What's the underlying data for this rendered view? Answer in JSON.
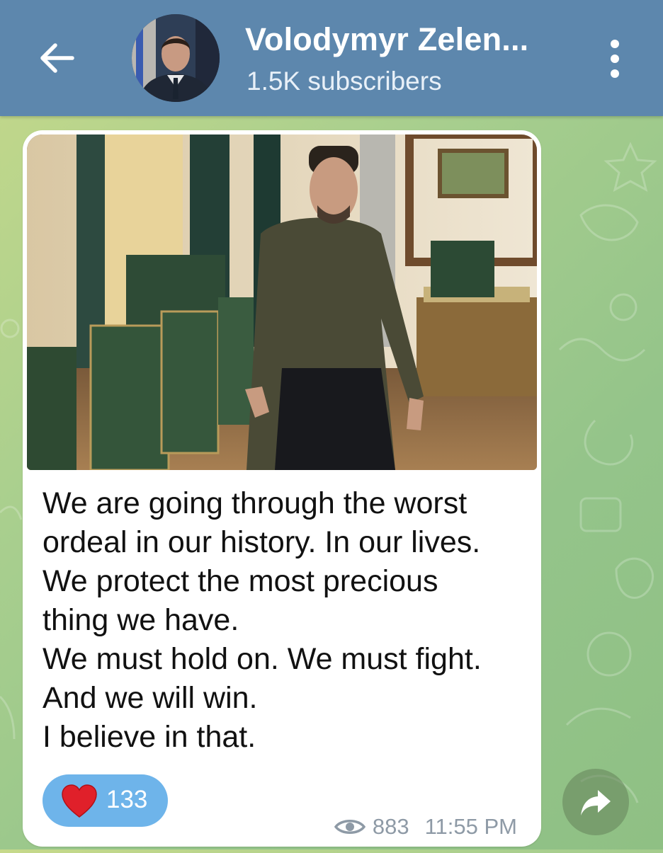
{
  "header": {
    "title": "Volodymyr Zelen...",
    "subtitle": "1.5K subscribers",
    "back_icon": "arrow-left-icon",
    "menu_icon": "more-vertical-icon",
    "background_color": "#5d87ad"
  },
  "message": {
    "lines": [
      "We are going through the worst",
      "ordeal in our history. In our lives.",
      "We protect the most precious",
      "thing we have.",
      "We must hold on. We must fight.",
      "And we will win.",
      "I believe in that."
    ],
    "reaction": {
      "icon": "heart-icon",
      "count": "133",
      "color": "#6eb4ea"
    },
    "views": "883",
    "time": "11:55 PM"
  },
  "share": {
    "icon": "share-arrow-icon"
  }
}
